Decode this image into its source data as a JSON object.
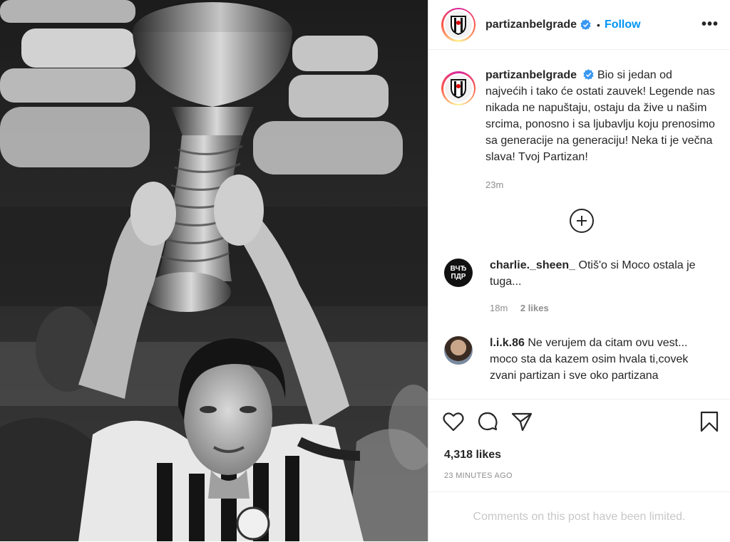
{
  "post": {
    "username": "partizanbelgrade",
    "dot": "•",
    "follow_label": "Follow",
    "more_label": "•••",
    "caption": "Bio si jedan od najvećih i tako će ostati zauvek! Legende nas nikada ne napuštaju, ostaju da žive u našim srcima, ponosno i sa ljubavlju koju prenosimo sa generacije na generaciju! Neka ti je večna slava! Tvoj Partizan!",
    "caption_time": "23m",
    "likes": "4,318 likes",
    "posted_ago": "23 MINUTES AGO",
    "comments_limited": "Comments on this post have been limited."
  },
  "comments": [
    {
      "username": "charlie._sheen_",
      "avatar_text": "ВЧЂ ПДР",
      "text": "Otiš'o si Moco ostala je tuga...",
      "time": "18m",
      "likes": "2 likes"
    },
    {
      "username": "l.i.k.86",
      "text": "Ne verujem da citam ovu vest... moco sta da kazem osim hvala ti,covek zvani partizan i sve oko partizana"
    }
  ],
  "icons": {
    "verified": "verified-badge-icon",
    "like": "heart-icon",
    "comment": "speech-bubble-icon",
    "share": "paper-plane-icon",
    "save": "bookmark-icon",
    "expand": "plus-circle-icon"
  },
  "colors": {
    "accent": "#0095f6",
    "verified": "#3897f0",
    "muted": "#8e8e8e"
  }
}
